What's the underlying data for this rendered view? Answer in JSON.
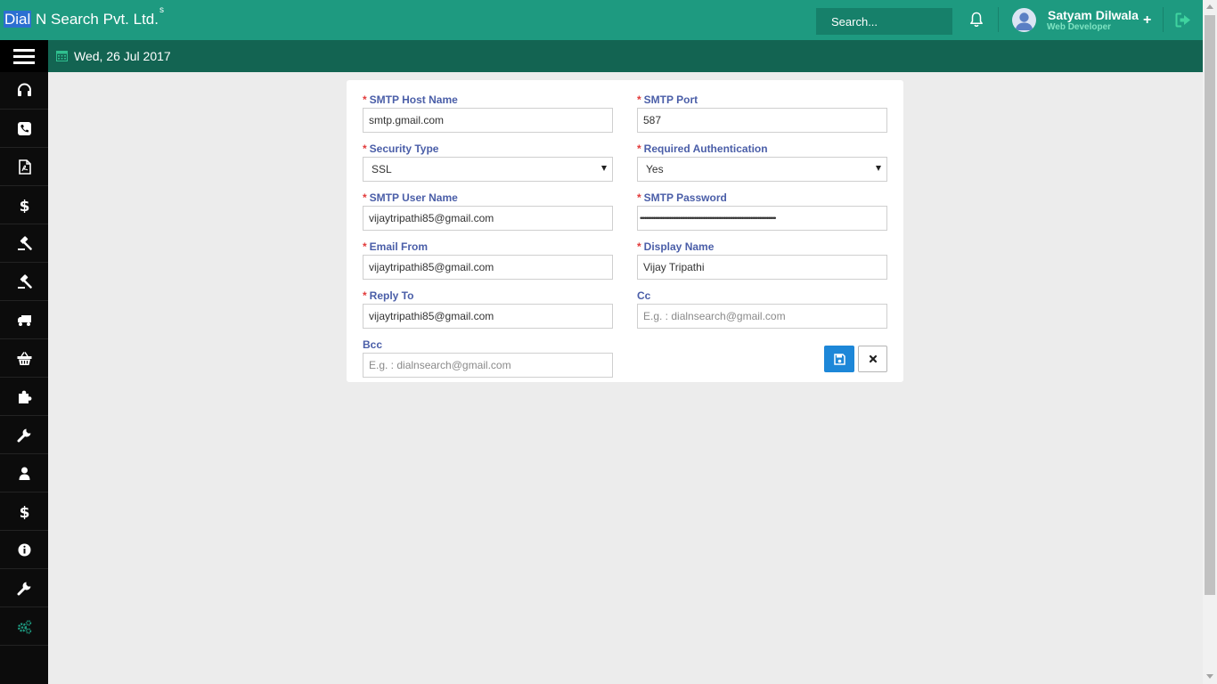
{
  "header": {
    "brand_highlight": "Dial",
    "brand_rest": " N Search Pvt. Ltd.",
    "brand_sup": "s",
    "search_placeholder": "Search...",
    "user_name": "Satyam Dilwala",
    "user_role": "Web Developer",
    "plus_label": "+",
    "icons": [
      "bell-icon",
      "avatar",
      "plus-icon",
      "logout-icon"
    ]
  },
  "subbar": {
    "date": "Wed, 26 Jul 2017",
    "icons": [
      "hamburger-icon",
      "calendar-icon"
    ]
  },
  "sidebar": {
    "items": [
      {
        "icon": "headset-icon"
      },
      {
        "icon": "phone-icon"
      },
      {
        "icon": "pdf-icon"
      },
      {
        "icon": "dollar-icon"
      },
      {
        "icon": "gavel-icon"
      },
      {
        "icon": "gavel-icon"
      },
      {
        "icon": "truck-icon"
      },
      {
        "icon": "basket-icon"
      },
      {
        "icon": "puzzle-icon"
      },
      {
        "icon": "wrench-icon"
      },
      {
        "icon": "user-icon"
      },
      {
        "icon": "dollar-icon"
      },
      {
        "icon": "info-icon"
      },
      {
        "icon": "wrench-icon"
      },
      {
        "icon": "cogs-icon",
        "active": true
      }
    ],
    "active_color": "#1e9a80"
  },
  "form": {
    "required_marker": "*",
    "smtp_host": {
      "label": "SMTP Host Name",
      "value": "smtp.gmail.com"
    },
    "smtp_port": {
      "label": "SMTP Port",
      "value": "587"
    },
    "security_type": {
      "label": "Security Type",
      "value": "SSL"
    },
    "required_auth": {
      "label": "Required Authentication",
      "value": "Yes"
    },
    "smtp_user": {
      "label": "SMTP User Name",
      "value": "vijaytripathi85@gmail.com"
    },
    "smtp_password": {
      "label": "SMTP Password",
      "value": "••••••••••••••••••••••••••••••••••••••••••••••••••••••••••••••••••••••••••••••••••••••••••••"
    },
    "email_from": {
      "label": "Email From",
      "value": "vijaytripathi85@gmail.com"
    },
    "display_name": {
      "label": "Display Name",
      "value": "Vijay Tripathi"
    },
    "reply_to": {
      "label": "Reply To",
      "value": "vijaytripathi85@gmail.com"
    },
    "cc": {
      "label": "Cc",
      "placeholder": "E.g. : dialnsearch@gmail.com"
    },
    "bcc": {
      "label": "Bcc",
      "placeholder": "E.g. : dialnsearch@gmail.com"
    },
    "buttons": {
      "save": "save-icon",
      "cancel": "close-icon"
    }
  },
  "colors": {
    "header": "#1e9a80",
    "subbar": "#136452",
    "label": "#4a5ea8",
    "required": "#e23b3b",
    "save_button": "#1d87d8"
  }
}
